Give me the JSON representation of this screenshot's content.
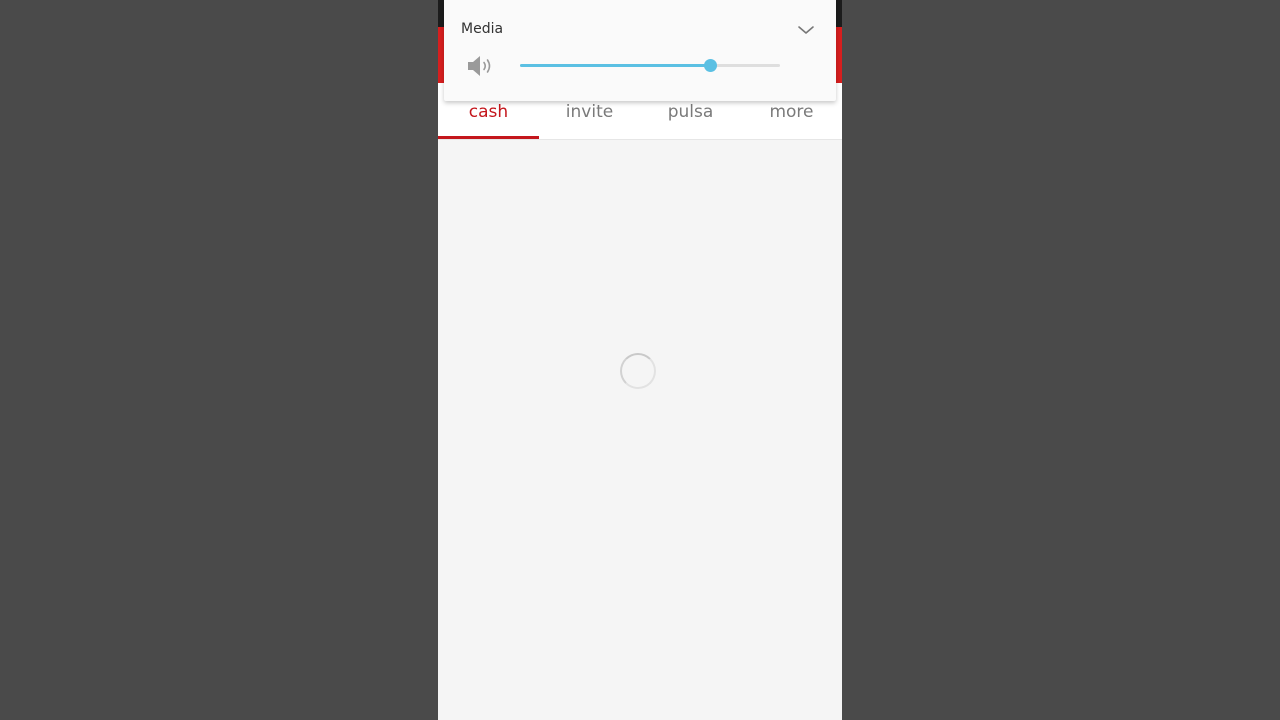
{
  "volume_panel": {
    "title": "Media",
    "level": 0.73,
    "speaker_icon": "speaker-icon",
    "collapse_icon": "chevron-down-icon",
    "accent_color": "#5bc0e3"
  },
  "tabs": [
    {
      "label": "cash",
      "active": true
    },
    {
      "label": "invite",
      "active": false
    },
    {
      "label": "pulsa",
      "active": false
    },
    {
      "label": "more",
      "active": false
    }
  ],
  "colors": {
    "brand": "#d71e1e",
    "active_tab": "#c4161c",
    "background": "#4a4a4a"
  },
  "loading": true
}
